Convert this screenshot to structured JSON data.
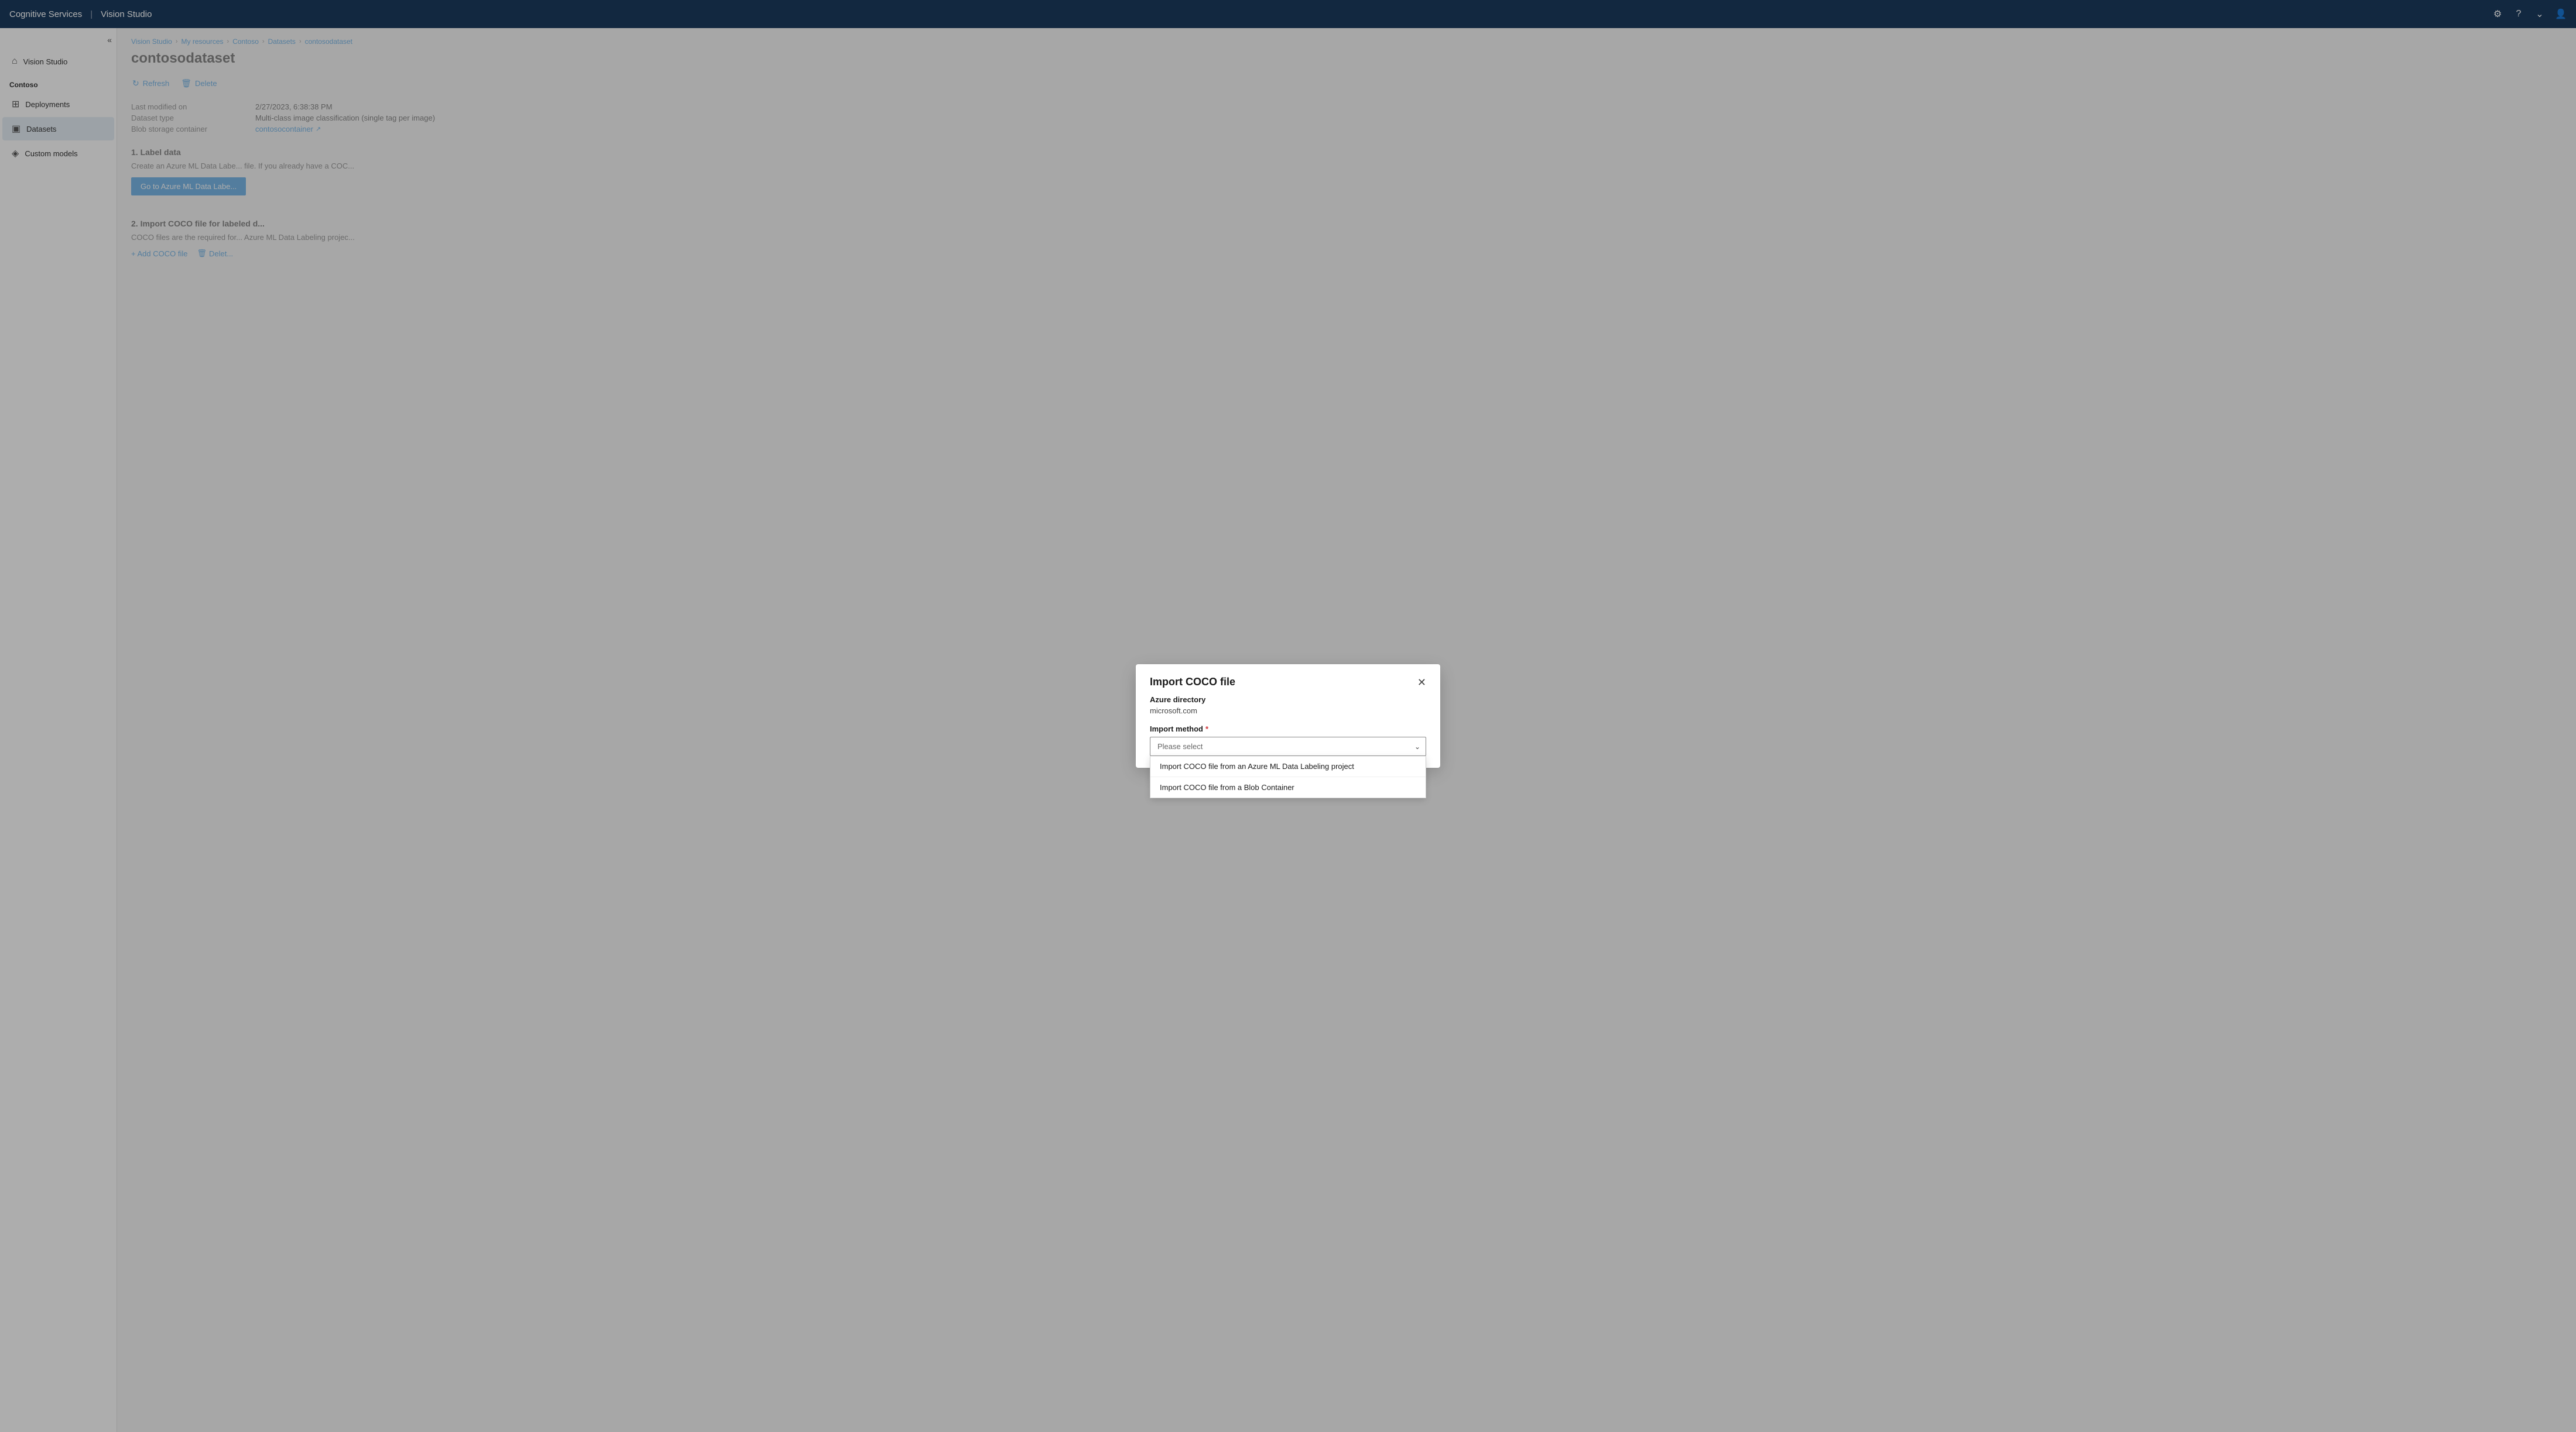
{
  "app": {
    "title": "Cognitive Services",
    "subtitle": "Vision Studio"
  },
  "topbar": {
    "gear_icon": "⚙",
    "help_icon": "?",
    "chevron_icon": "⌄",
    "avatar_icon": "👤"
  },
  "sidebar": {
    "collapse_icon": "«",
    "home_icon": "⌂",
    "home_label": "Vision Studio",
    "section_label": "Contoso",
    "deployments_icon": "⊞",
    "deployments_label": "Deployments",
    "datasets_icon": "▣",
    "datasets_label": "Datasets",
    "custom_models_icon": "◈",
    "custom_models_label": "Custom models"
  },
  "breadcrumb": {
    "items": [
      "Vision Studio",
      "My resources",
      "Contoso",
      "Datasets",
      "contosodataset"
    ]
  },
  "page": {
    "title": "contosodataset",
    "refresh_label": "Refresh",
    "delete_label": "Delete"
  },
  "metadata": {
    "last_modified_label": "Last modified on",
    "last_modified_value": "2/27/2023, 6:38:38 PM",
    "dataset_type_label": "Dataset type",
    "dataset_type_value": "Multi-class image classification (single tag per image)",
    "blob_container_label": "Blob storage container",
    "blob_container_value": "contosocontainer",
    "blob_container_icon": "↗"
  },
  "section1": {
    "title": "1. Label data",
    "description": "Create an Azure ML Data Labe... file. If you already have a COC...",
    "button_label": "Go to Azure ML Data Labe..."
  },
  "section2": {
    "title": "2. Import COCO file for labeled d...",
    "description": "COCO files are the required for... Azure ML Data Labeling projec...",
    "add_coco_label": "+ Add COCO file",
    "delete_label": "Delet..."
  },
  "modal": {
    "title": "Import COCO file",
    "close_icon": "✕",
    "azure_directory_label": "Azure directory",
    "azure_directory_value": "microsoft.com",
    "import_method_label": "Import method",
    "required_star": "*",
    "dropdown_placeholder": "Please select",
    "dropdown_arrow": "⌄",
    "options": [
      "Import COCO file from an Azure ML Data Labeling project",
      "Import COCO file from a Blob Container"
    ]
  }
}
